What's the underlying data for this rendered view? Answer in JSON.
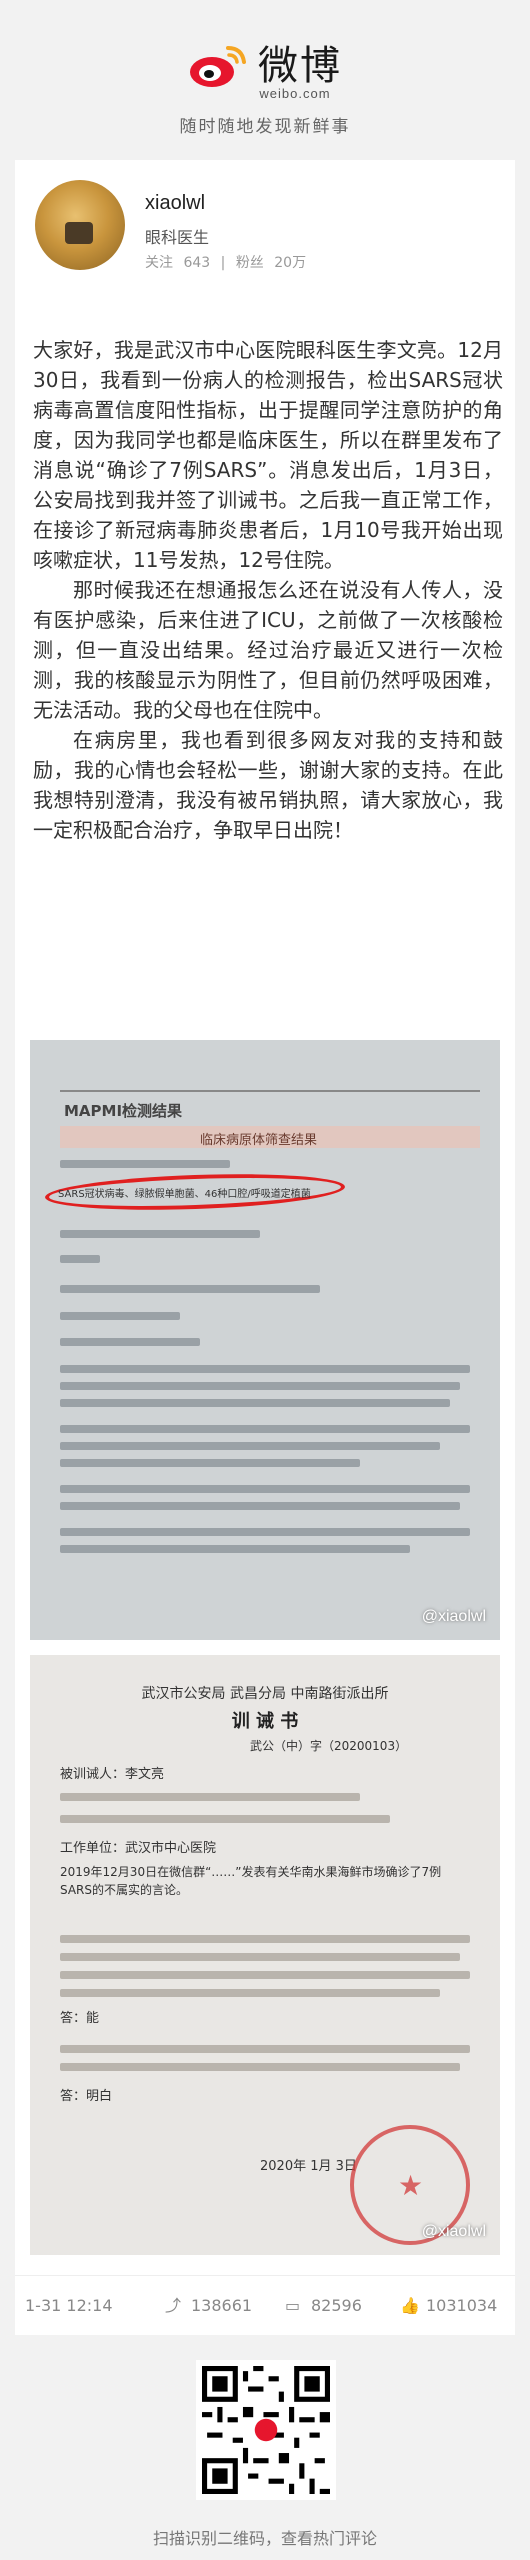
{
  "header": {
    "brand": "微博",
    "domain": "weibo.com",
    "slogan": "随时随地发现新鲜事"
  },
  "profile": {
    "username": "xiaolwl",
    "bio": "眼科医生",
    "following_label": "关注",
    "following_count": "643",
    "separator": "|",
    "followers_label": "粉丝",
    "followers_count": "20万"
  },
  "post": {
    "paragraphs": [
      "大家好，我是武汉市中心医院眼科医生李文亮。12月30日，我看到一份病人的检测报告，检出SARS冠状病毒高置信度阳性指标，出于提醒同学注意防护的角度，因为我同学也都是临床医生，所以在群里发布了消息说“确诊了7例SARS”。消息发出后，1月3日，公安局找到我并签了训诫书。之后我一直正常工作，在接诊了新冠病毒肺炎患者后，1月10号我开始出现咳嗽症状，11号发热，12号住院。",
      "那时候我还在想通报怎么还在说没有人传人，没有医护感染，后来住进了ICU，之前做了一次核酸检测，但一直没出结果。经过治疗最近又进行一次检测，我的核酸显示为阴性了，但目前仍然呼吸困难，无法活动。我的父母也在住院中。",
      "在病房里，我也看到很多网友对我的支持和鼓励，我的心情也会轻松一些，谢谢大家的支持。在此我想特别澄清，我没有被吊销执照，请大家放心，我一定积极配合治疗，争取早日出院！"
    ]
  },
  "image1": {
    "watermark": "@xiaolwl",
    "title": "MAPMI检测结果",
    "subtitle": "临床病原体筛查结果",
    "highlight": "SARS冠状病毒、绿脓假单胞菌、46种口腔/呼吸道定植菌"
  },
  "image2": {
    "watermark": "@xiaolwl",
    "org": "武汉市公安局 武昌分局 中南路街派出所",
    "title": "训 诫 书",
    "doc_no": "武公（中）字（20200103）",
    "name_field": "被训诫人：李文亮",
    "workplace": "工作单位：武汉市中心医院",
    "statement": "2019年12月30日在微信群“……”发表有关华南水果海鲜市场确诊了7例SARS的不属实的言论。",
    "answer1": "答：能",
    "answer2": "答：明白",
    "date": "2020年 1月 3日"
  },
  "footer": {
    "time": "1-31 12:14",
    "reposts": "138661",
    "comments": "82596",
    "likes": "1031034"
  },
  "qr": {
    "caption": "扫描识别二维码，查看热门评论"
  },
  "colors": {
    "brand_red": "#e6162d",
    "brand_orange": "#f5a623",
    "highlight_ring": "#e02020"
  }
}
